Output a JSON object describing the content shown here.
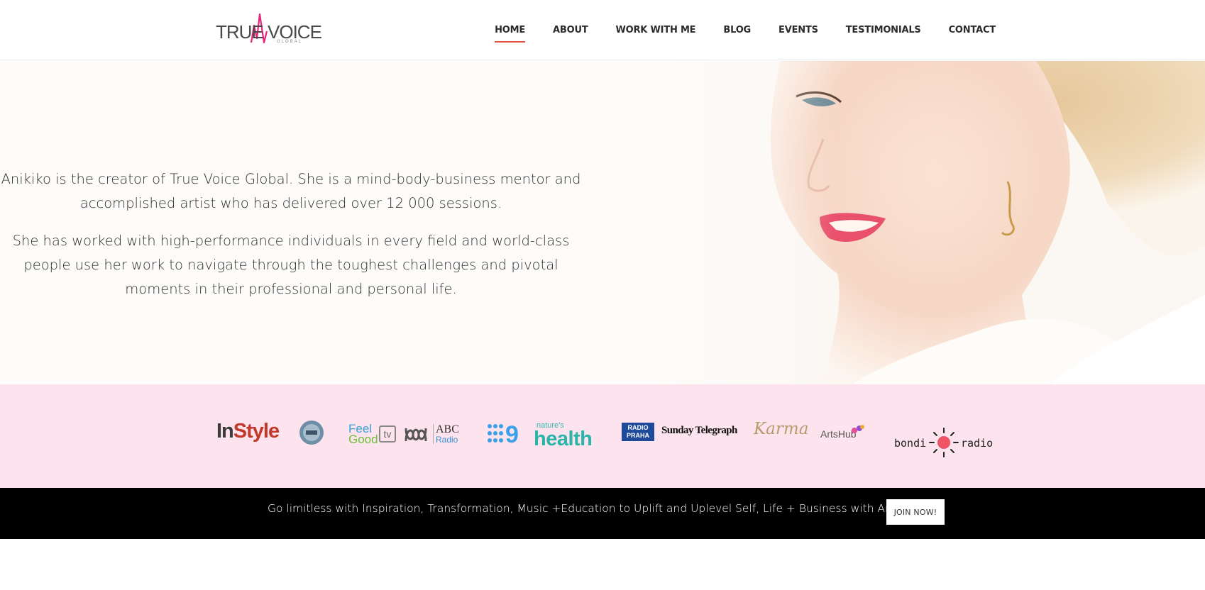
{
  "brand": {
    "logo_text": "TRUE VOICE",
    "logo_sub": "GLOBAL",
    "accent_color": "#e2553f",
    "logo_color": "#e8247b"
  },
  "nav": {
    "items": [
      {
        "label": "HOME",
        "active": true
      },
      {
        "label": "ABOUT"
      },
      {
        "label": "WORK WITH ME"
      },
      {
        "label": "BLOG"
      },
      {
        "label": "EVENTS"
      },
      {
        "label": "TESTIMONIALS"
      },
      {
        "label": "CONTACT"
      }
    ]
  },
  "hero": {
    "paragraph_1": "Anikiko is the creator of True Voice Global. She is a mind-body-business mentor and accomplished artist who has delivered over 12 000 sessions.",
    "paragraph_2": "She has worked with high-performance individuals in every field and world-class people use her work to navigate through the toughest challenges and pivotal moments in their professional and personal life.",
    "image_icon": "portrait-photo"
  },
  "press": {
    "logos": [
      "InStyle",
      "Feel Good tv",
      "ABC Radio",
      "9",
      "nature's health",
      "RADIO PRAHA",
      "The Sunday Telegraph",
      "Karma",
      "ArtsHub",
      "bondi",
      "radio"
    ]
  },
  "cta": {
    "text": "Go limitless with Inspiration, Transformation, Music +Education to Uplift and Uplevel Self, Life + Business with Anikiko !",
    "button_label": "JOIN NOW!"
  }
}
